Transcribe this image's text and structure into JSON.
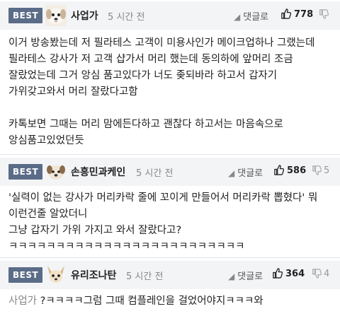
{
  "comments": [
    {
      "badge": "BEST",
      "author": "사업가",
      "time": "5 시간 전",
      "reply_label": "댓글로",
      "likes": "778",
      "dislikes": "",
      "text": "이거 방송봤는데 저 필라테스 고객이 미용사인가 메이크업하나 그랬는데 필라테스 강사가 저 고객 샵가서 머리 했는데 동의하에 앞머리 조금 잘랐었는데 그거 앙심 품고있다가 너도 좆되바라 하고서 갑자기 가위갖고와서 머리 잘랐다고함\n\n카톡보면 그때는 머리 맘에든다하고 괜찮다 하고서는 마음속으로 앙심품고있었던듯",
      "avatar_icon": "puppy-face-icon"
    },
    {
      "badge": "BEST",
      "author": "손흥민과케인",
      "time": "5 시간 전",
      "reply_label": "댓글로",
      "likes": "586",
      "dislikes": "5",
      "text": "'실력이 없는 강사가 머리카락 줄에 꼬이게 만들어서 머리카락 뽑혔다' 뭐 이런건줄 알았더니\n그냥 갑자기 가위 가지고 와서 잘랐다고?ㅋㅋㅋㅋㅋㅋㅋㅋㅋㅋㅋㅋㅋㅋㅋㅋㅋㅋㅋㅋㅋㅋㅋㅋㅋ",
      "avatar_icon": "dog-face-icon"
    },
    {
      "badge": "BEST",
      "author": "유리조나탄",
      "time": "5 시간 전",
      "reply_label": "댓글로",
      "likes": "364",
      "dislikes": "4",
      "mention": "사업가",
      "text": " ?ㅋㅋㅋㅋ그럼 그때 컴플레인을 걸었어야지ㅋㅋㅋ와",
      "avatar_icon": "chihuahua-face-icon"
    }
  ]
}
